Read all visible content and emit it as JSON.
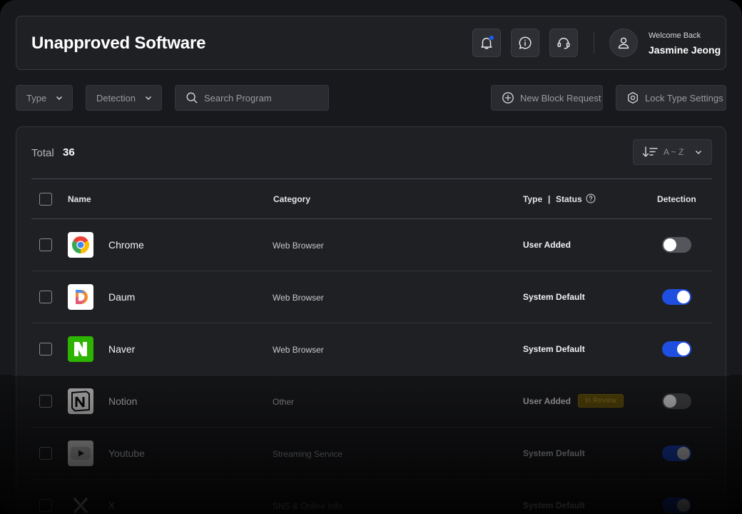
{
  "header": {
    "title": "Unapproved Software",
    "welcome": "Welcome Back",
    "user_name": "Jasmine Jeong",
    "buttons": [
      {
        "icon": "bell-icon",
        "has_notification": true
      },
      {
        "icon": "info-chat-icon"
      },
      {
        "icon": "headset-icon"
      }
    ]
  },
  "toolbar": {
    "type_filter": "Type",
    "detection_filter": "Detection",
    "search_placeholder": "Search Program",
    "new_block_request": "New Block Request",
    "lock_type_settings": "Lock Type Settings"
  },
  "list": {
    "total_label": "Total",
    "total_count": "36",
    "sort_label": "A ~ Z",
    "columns": {
      "name": "Name",
      "category": "Category",
      "type": "Type",
      "separator": "|",
      "status": "Status",
      "detection": "Detection"
    },
    "rows": [
      {
        "name": "Chrome",
        "icon": "chrome-icon",
        "category": "Web Browser",
        "type": "User Added",
        "badge": "",
        "detection": false
      },
      {
        "name": "Daum",
        "icon": "daum-icon",
        "category": "Web Browser",
        "type": "System Default",
        "badge": "",
        "detection": true
      },
      {
        "name": "Naver",
        "icon": "naver-icon",
        "category": "Web Browser",
        "type": "System Default",
        "badge": "",
        "detection": true
      },
      {
        "name": "Notion",
        "icon": "notion-icon",
        "category": "Other",
        "type": "User Added",
        "badge": "In Review",
        "detection": false
      },
      {
        "name": "Youtube",
        "icon": "youtube-icon",
        "category": "Streaming Service",
        "type": "System Default",
        "badge": "",
        "detection": true
      },
      {
        "name": "X",
        "icon": "x-icon",
        "category": "SNS & Online Info",
        "type": "System Default",
        "badge": "",
        "detection": true
      }
    ]
  },
  "colors": {
    "accent": "#1f4fe0",
    "badge": "#6f5a0c",
    "surface": "#1f2024"
  }
}
